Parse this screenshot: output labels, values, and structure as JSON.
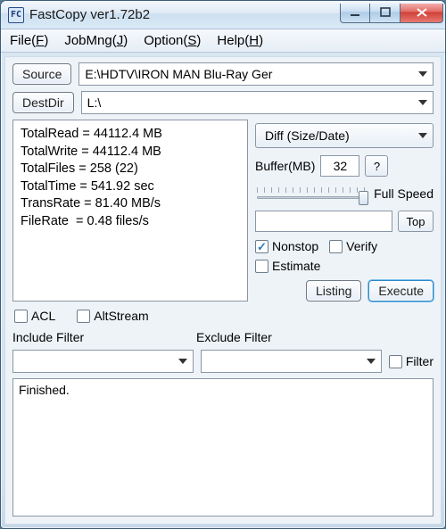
{
  "window": {
    "title": "FastCopy ver1.72b2",
    "icon_text": "FC"
  },
  "menu": {
    "file": "File(F)",
    "jobmng": "JobMng(J)",
    "option": "Option(S)",
    "help": "Help(H)"
  },
  "paths": {
    "source_btn": "Source",
    "source_value": "E:\\HDTV\\IRON MAN Blu-Ray Ger",
    "dest_btn": "DestDir",
    "dest_value": "L:\\"
  },
  "stats": {
    "TotalRead": "44112.4 MB",
    "TotalWrite": "44112.4 MB",
    "TotalFiles": "258 (22)",
    "TotalTime": "541.92 sec",
    "TransRate": "81.40 MB/s",
    "FileRate": "0.48 files/s"
  },
  "mode": {
    "selected": "Diff (Size/Date)"
  },
  "buffer": {
    "label": "Buffer(MB)",
    "value": "32",
    "help": "?"
  },
  "speed": {
    "label": "Full Speed"
  },
  "toprow": {
    "value": "",
    "top_btn": "Top"
  },
  "checks": {
    "nonstop": {
      "label": "Nonstop",
      "checked": true
    },
    "verify": {
      "label": "Verify",
      "checked": false
    },
    "estimate": {
      "label": "Estimate",
      "checked": false
    }
  },
  "actions": {
    "listing": "Listing",
    "execute": "Execute"
  },
  "acl": {
    "acl": {
      "label": "ACL",
      "checked": false
    },
    "altstream": {
      "label": "AltStream",
      "checked": false
    }
  },
  "filters": {
    "include_label": "Include Filter",
    "exclude_label": "Exclude Filter",
    "include_value": "",
    "exclude_value": "",
    "filter_chk": {
      "label": "Filter",
      "checked": false
    }
  },
  "log": {
    "text": "Finished."
  }
}
